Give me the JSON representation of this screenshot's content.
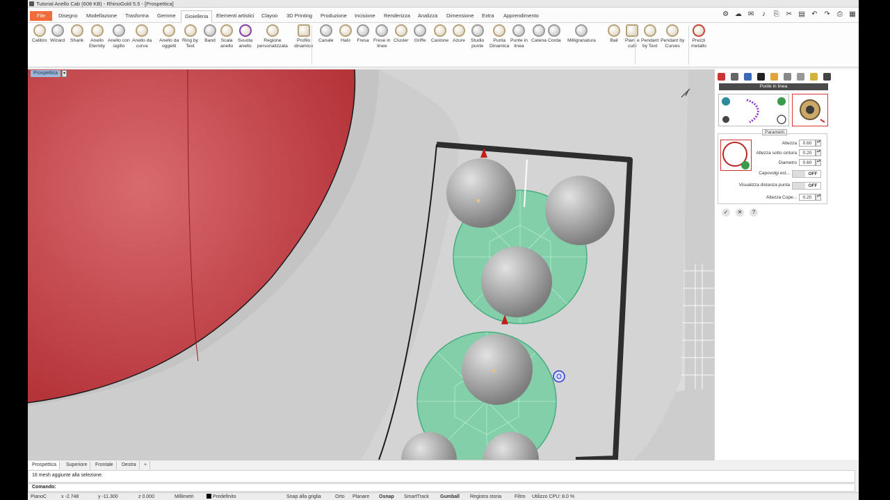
{
  "title": "Tutorial Anello Cab (608 KB) - RhinoGold 5.5 - [Prospettica]",
  "menu": {
    "tabs": [
      "File",
      "Disegno",
      "Modellazione",
      "Trasforma",
      "Gemme",
      "Gioielleria",
      "Elementi artistici",
      "Clayoo",
      "3D Printing",
      "Produzione",
      "Incisione",
      "Renderizza",
      "Analizza",
      "Dimensione",
      "Extra",
      "Apprendimento"
    ],
    "active": "Gioielleria"
  },
  "ribbon": {
    "items": [
      "Calibro",
      "Wizard",
      "Shank",
      "Anello\nEternity",
      "Anello con\nsigillo",
      "Anello da\ncurva",
      "Anello da\noggetti",
      "Ring by\nText",
      "Band",
      "Scala\nanello",
      "Svuota\nanello",
      "Regione\npersonalizzata",
      "Profilo\ndinamico",
      "Canale",
      "Halo",
      "Fresa",
      "Frese in\nlinee",
      "Cluster",
      "Griffe",
      "Castone",
      "Azure",
      "Studio\npunte",
      "Punta\nDinamica",
      "Punte in\nlinea",
      "Catena",
      "Corda",
      "Milligranatura",
      "Bail",
      "Piani e\ncubi",
      "Pendant\nby Text",
      "Pendant by\nCurves",
      "Prezzi\nmetallo"
    ]
  },
  "viewport": {
    "label": "Prospettica",
    "colors": {
      "ring": "#b5343a",
      "metal": "#d4d4d4",
      "gem": "#73c8a0",
      "prong": "#9a9a9a"
    }
  },
  "panel": {
    "title": "Punte in linea",
    "section": "Parametri",
    "params": [
      {
        "label": "Altezza",
        "value": "0.60"
      },
      {
        "label": "Altezza sotto cintura",
        "value": "0.20"
      },
      {
        "label": "Diametro",
        "value": "0.60"
      },
      {
        "label": "Capovolgi est...",
        "toggle": "OFF"
      },
      {
        "label": "Visualizza distanza punta",
        "toggle": "OFF"
      },
      {
        "label": "Altezza Cope...",
        "value": "0.20"
      }
    ]
  },
  "viewtabs": [
    "Prospettica",
    "Superiore",
    "Frontale",
    "Destra"
  ],
  "command": {
    "history": "16 mesh aggiunte alla selezione.",
    "prompt": "Comando:"
  },
  "status": {
    "plane": "PianoC",
    "x": "x -2.748",
    "y": "y -11.300",
    "z": "z 0.000",
    "units": "Millimetri",
    "layer": "Predefinito",
    "toggles": [
      "Snap alla griglia",
      "Orto",
      "Planare",
      "Osnap",
      "SmartTrack",
      "Gumball",
      "Registra storia",
      "Filtro"
    ],
    "cpu": "Utilizzo CPU: 8.0 %"
  }
}
